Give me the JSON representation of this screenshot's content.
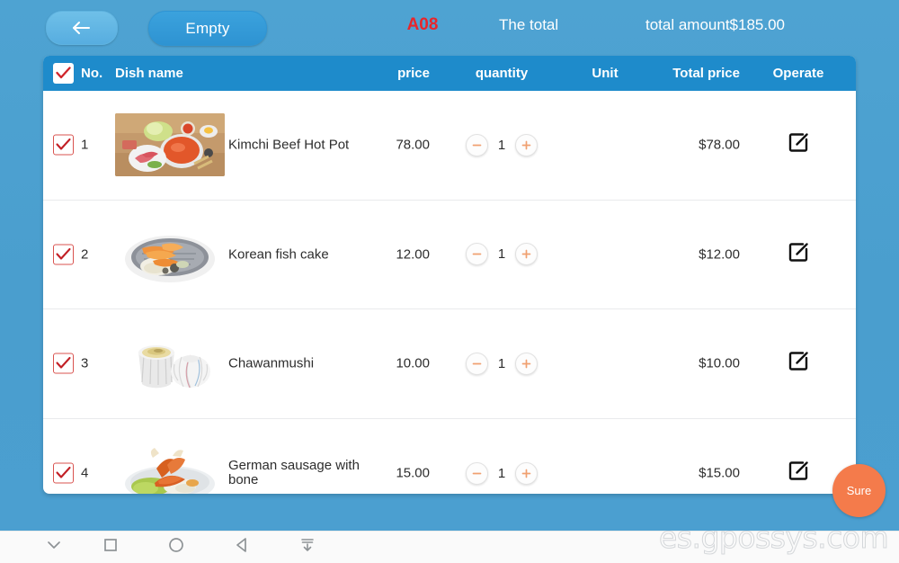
{
  "app": {
    "background_color": "#4ba0d0",
    "accent_header_color": "#1e8bcb",
    "accent_confirm_color": "#f47b4b",
    "alert_color": "#c22026"
  },
  "topbar": {
    "back_label": "back-arrow",
    "empty_label": "Empty",
    "table_code": "A08",
    "total_label": "The total",
    "total_amount": "total amount$185.00"
  },
  "table": {
    "headers": {
      "no": "No.",
      "dish_name": "Dish name",
      "price": "price",
      "quantity": "quantity",
      "unit": "Unit",
      "total_price": "Total price",
      "operate": "Operate"
    },
    "select_all_checked": true,
    "rows": [
      {
        "no": "1",
        "checked": true,
        "dish_name": "Kimchi Beef Hot Pot",
        "image": "kimchi-beef-hot-pot-photo",
        "price": "78.00",
        "quantity": "1",
        "unit": "",
        "total_price": "$78.00",
        "operate_icon": "edit-icon",
        "minus_label": "−",
        "plus_label": "+"
      },
      {
        "no": "2",
        "checked": true,
        "dish_name": "Korean fish cake",
        "image": "korean-fish-cake-photo",
        "price": "12.00",
        "quantity": "1",
        "unit": "",
        "total_price": "$12.00",
        "operate_icon": "edit-icon",
        "minus_label": "−",
        "plus_label": "+"
      },
      {
        "no": "3",
        "checked": true,
        "dish_name": "Chawanmushi",
        "image": "chawanmushi-photo",
        "price": "10.00",
        "quantity": "1",
        "unit": "",
        "total_price": "$10.00",
        "operate_icon": "edit-icon",
        "minus_label": "−",
        "plus_label": "+"
      },
      {
        "no": "4",
        "checked": true,
        "dish_name": "German sausage with bone",
        "image": "german-sausage-with-bone-photo",
        "price": "15.00",
        "quantity": "1",
        "unit": "",
        "total_price": "$15.00",
        "operate_icon": "edit-icon",
        "minus_label": "−",
        "plus_label": "+"
      }
    ]
  },
  "confirm": {
    "label": "Sure"
  },
  "watermark": {
    "text": "es.gpossys.com"
  },
  "navbar": {
    "items": [
      {
        "icon": "chevron-down-icon"
      },
      {
        "icon": "square-icon"
      },
      {
        "icon": "circle-icon"
      },
      {
        "icon": "back-triangle-icon"
      },
      {
        "icon": "hide-keyboard-icon"
      }
    ]
  }
}
